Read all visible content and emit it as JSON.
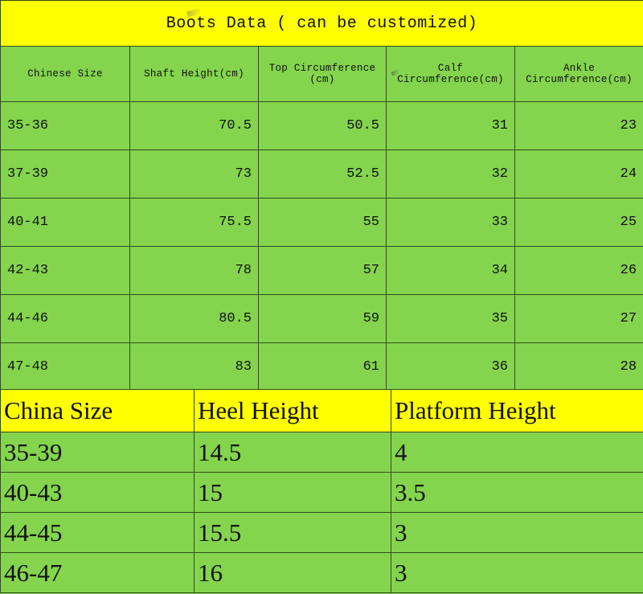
{
  "table1": {
    "title": "Boots Data ( can be customized)",
    "columns": [
      "Chinese Size",
      "Shaft Height(cm)",
      "Top Circumference (cm)",
      "Calf Circumference(cm)",
      "Ankle Circumference(cm)"
    ],
    "rows": [
      [
        "35-36",
        "70.5",
        "50.5",
        "31",
        "23"
      ],
      [
        "37-39",
        "73",
        "52.5",
        "32",
        "24"
      ],
      [
        "40-41",
        "75.5",
        "55",
        "33",
        "25"
      ],
      [
        "42-43",
        "78",
        "57",
        "34",
        "26"
      ],
      [
        "44-46",
        "80.5",
        "59",
        "35",
        "27"
      ],
      [
        "47-48",
        "83",
        "61",
        "36",
        "28"
      ]
    ]
  },
  "table2": {
    "columns": [
      "China Size",
      "Heel Height",
      "Platform Height"
    ],
    "rows": [
      [
        "35-39",
        "14.5",
        "4"
      ],
      [
        "40-43",
        "15",
        "3.5"
      ],
      [
        "44-45",
        "15.5",
        "3"
      ],
      [
        "46-47",
        "16",
        "3"
      ]
    ]
  },
  "colors": {
    "header_yellow": "#ffff00",
    "cell_green": "#84d44e",
    "border": "#2f4f1a",
    "text": "#111111"
  }
}
